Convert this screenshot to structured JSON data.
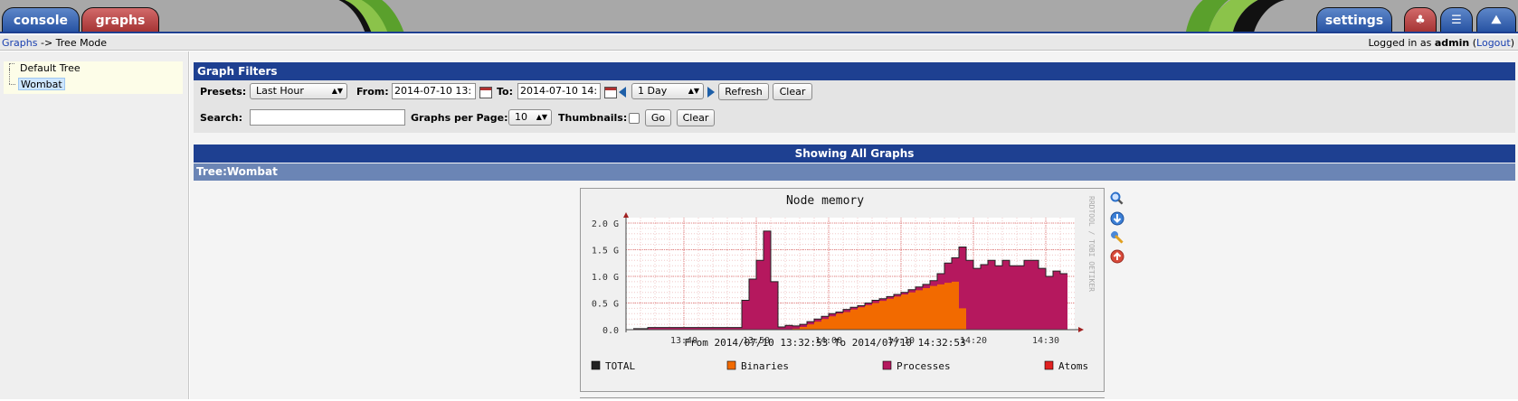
{
  "topnav": {
    "console_label": "console",
    "graphs_label": "graphs",
    "settings_label": "settings"
  },
  "breadcrumb": {
    "link": "Graphs",
    "rest": " -> Tree Mode",
    "login_prefix": "Logged in as ",
    "user": "admin",
    "logout_open": " (",
    "logout_link": "Logout",
    "logout_close": ")"
  },
  "tree": {
    "items": [
      {
        "label": "Default Tree",
        "selected": false
      },
      {
        "label": "Wombat",
        "selected": true
      }
    ]
  },
  "filters": {
    "title": "Graph Filters",
    "presets_label": "Presets:",
    "presets_value": "Last Hour",
    "from_label": "From:",
    "from_value": "2014-07-10 13:",
    "to_label": "To:",
    "to_value": "2014-07-10 14:",
    "span_value": "1 Day",
    "refresh_label": "Refresh",
    "clear_label": "Clear",
    "search_label": "Search:",
    "search_value": "",
    "gpp_label": "Graphs per Page:",
    "gpp_value": "10",
    "thumbs_label": "Thumbnails:",
    "go_label": "Go",
    "clear2_label": "Clear"
  },
  "showing": "Showing All Graphs",
  "tree_header": {
    "prefix": "Tree:",
    "name": "Wombat"
  },
  "colors": {
    "nav_blue": "#1e4091",
    "tree_header": "#6b85b5",
    "processes": "#b5185e",
    "binaries": "#f26a00",
    "atoms": "#e02020",
    "total": "#222222"
  },
  "graph_icons": [
    "zoom-icon",
    "export-icon",
    "edit-icon",
    "remove-icon"
  ],
  "chart_data": {
    "type": "area",
    "title": "Node memory",
    "watermark": "RRDTOOL / TOBI OETIKER",
    "subtitle": "From 2014/07/10 13:32:53 To 2014/07/10 14:32:53",
    "yticks": [
      "0.0",
      "0.5 G",
      "1.0 G",
      "1.5 G",
      "2.0 G"
    ],
    "ylim": [
      0,
      2.0
    ],
    "xticks": [
      "13:40",
      "13:50",
      "14:00",
      "14:10",
      "14:20",
      "14:30"
    ],
    "x_minutes": [
      33,
      35,
      37,
      39,
      41,
      43,
      45,
      47,
      48,
      49,
      50,
      51,
      52,
      53,
      54,
      55,
      56,
      57,
      58,
      59,
      60,
      61,
      62,
      63,
      64,
      65,
      66,
      67,
      68,
      69,
      70,
      71,
      72,
      73,
      74,
      75,
      76,
      77,
      78,
      79,
      80,
      81,
      82,
      83,
      84,
      85,
      86,
      87,
      88,
      89,
      90,
      91,
      92
    ],
    "series": [
      {
        "name": "Processes",
        "values": [
          0.02,
          0.04,
          0.04,
          0.04,
          0.04,
          0.04,
          0.04,
          0.04,
          0.55,
          0.95,
          1.3,
          1.85,
          0.9,
          0.05,
          0.08,
          0.07,
          0.1,
          0.15,
          0.2,
          0.25,
          0.3,
          0.33,
          0.38,
          0.42,
          0.45,
          0.5,
          0.55,
          0.58,
          0.62,
          0.66,
          0.7,
          0.75,
          0.8,
          0.85,
          0.92,
          1.05,
          1.25,
          1.35,
          1.55,
          1.3,
          1.15,
          1.22,
          1.3,
          1.2,
          1.3,
          1.2,
          1.2,
          1.3,
          1.3,
          1.15,
          1.0,
          1.1,
          1.05
        ]
      },
      {
        "name": "Binaries",
        "values": [
          0,
          0,
          0,
          0,
          0,
          0,
          0,
          0,
          0,
          0,
          0,
          0,
          0,
          0,
          0,
          0.02,
          0.05,
          0.1,
          0.15,
          0.2,
          0.25,
          0.3,
          0.33,
          0.38,
          0.42,
          0.46,
          0.5,
          0.54,
          0.58,
          0.62,
          0.66,
          0.7,
          0.74,
          0.78,
          0.82,
          0.85,
          0.88,
          0.9,
          0.4,
          0,
          0,
          0,
          0,
          0,
          0,
          0,
          0,
          0,
          0,
          0,
          0,
          0,
          0
        ]
      },
      {
        "name": "Atoms",
        "values": []
      },
      {
        "name": "TOTAL",
        "values": [
          0.02,
          0.04,
          0.04,
          0.04,
          0.04,
          0.04,
          0.04,
          0.04,
          0.55,
          0.95,
          1.3,
          1.85,
          0.9,
          0.05,
          0.08,
          0.07,
          0.1,
          0.15,
          0.2,
          0.25,
          0.3,
          0.33,
          0.38,
          0.42,
          0.45,
          0.5,
          0.55,
          0.58,
          0.62,
          0.66,
          0.7,
          0.75,
          0.8,
          0.85,
          0.92,
          1.05,
          1.25,
          1.35,
          1.55,
          1.3,
          1.15,
          1.22,
          1.3,
          1.2,
          1.3,
          1.2,
          1.2,
          1.3,
          1.3,
          1.15,
          1.0,
          1.1,
          1.05
        ]
      }
    ],
    "legend": [
      "TOTAL",
      "Binaries",
      "Processes",
      "Atoms"
    ]
  }
}
